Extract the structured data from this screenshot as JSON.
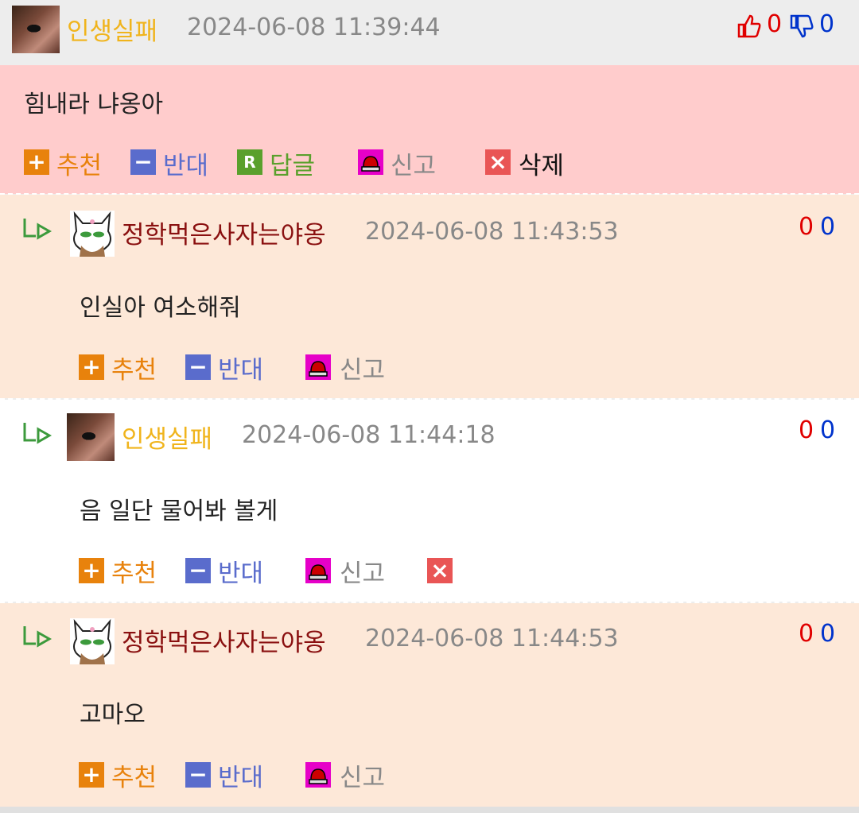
{
  "comments": [
    {
      "nickname": "인생실패",
      "timestamp": "2024-06-08 11:39:44",
      "text": "힘내라 냐옹아",
      "likes": "0",
      "dislikes": "0",
      "actions": {
        "recommend": "추천",
        "oppose": "반대",
        "reply": "답글",
        "report": "신고",
        "delete": "삭제"
      }
    },
    {
      "nickname": "정학먹은사자는야옹",
      "timestamp": "2024-06-08 11:43:53",
      "text": "인실아 여소해줘",
      "likes": "0",
      "dislikes": "0",
      "actions": {
        "recommend": "추천",
        "oppose": "반대",
        "report": "신고"
      }
    },
    {
      "nickname": "인생실패",
      "timestamp": "2024-06-08 11:44:18",
      "text": "음 일단 물어봐 볼게",
      "likes": "0",
      "dislikes": "0",
      "actions": {
        "recommend": "추천",
        "oppose": "반대",
        "report": "신고"
      }
    },
    {
      "nickname": "정학먹은사자는야옹",
      "timestamp": "2024-06-08 11:44:53",
      "text": "고마오",
      "likes": "0",
      "dislikes": "0",
      "actions": {
        "recommend": "추천",
        "oppose": "반대",
        "report": "신고"
      }
    }
  ],
  "icons": {
    "plus": "+",
    "minus": "−",
    "reply": "R",
    "close": "×"
  },
  "colors": {
    "nick_author": "#f0b41c",
    "nick_other": "#8a1010",
    "recommend": "#e8820c",
    "oppose": "#5a6ccc",
    "reply": "#5aa02c",
    "report_box": "#e600c8",
    "delete_box": "#e95555",
    "like_count": "#e00000",
    "dislike_count": "#0033cc",
    "top_bg": "#ffcccc",
    "reply_bg_a": "#fde8d8",
    "reply_bg_b": "#ffffff"
  }
}
